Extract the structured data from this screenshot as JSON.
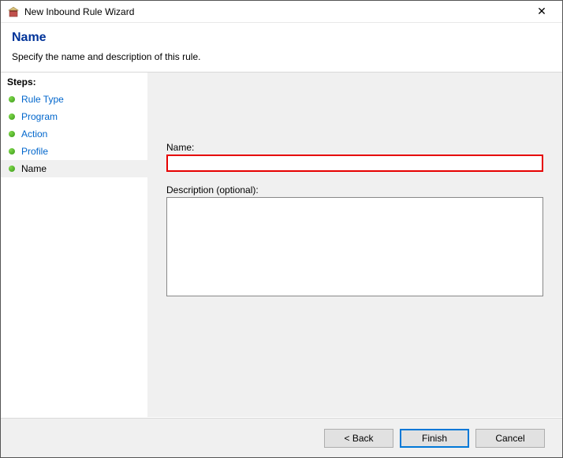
{
  "window": {
    "title": "New Inbound Rule Wizard",
    "close_glyph": "✕"
  },
  "header": {
    "title": "Name",
    "subtitle": "Specify the name and description of this rule."
  },
  "sidebar": {
    "steps_label": "Steps:",
    "items": [
      {
        "label": "Rule Type",
        "state": "completed"
      },
      {
        "label": "Program",
        "state": "completed"
      },
      {
        "label": "Action",
        "state": "completed"
      },
      {
        "label": "Profile",
        "state": "completed"
      },
      {
        "label": "Name",
        "state": "current"
      }
    ]
  },
  "form": {
    "name_label": "Name:",
    "name_value": "",
    "description_label": "Description (optional):",
    "description_value": ""
  },
  "footer": {
    "back_label": "< Back",
    "finish_label": "Finish",
    "cancel_label": "Cancel"
  }
}
